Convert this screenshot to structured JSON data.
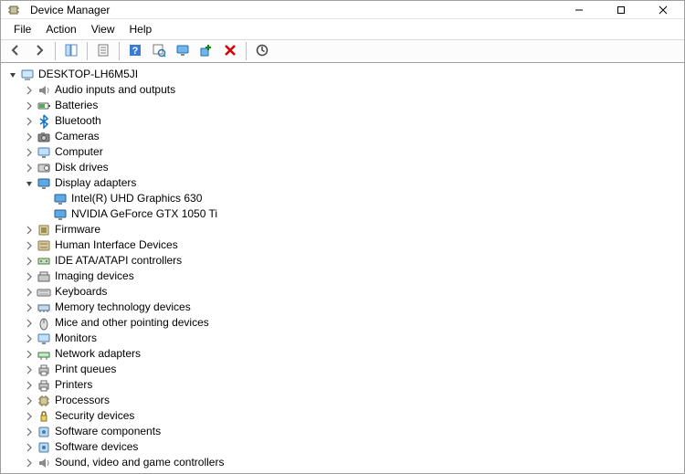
{
  "window": {
    "title": "Device Manager"
  },
  "menu": {
    "file": "File",
    "action": "Action",
    "view": "View",
    "help": "Help"
  },
  "toolbar_icons": {
    "back": "back-arrow",
    "forward": "forward-arrow",
    "showhide": "show-hide-console-tree",
    "properties": "properties",
    "help": "help",
    "scan": "scan-for-hardware-changes",
    "addlegacy": "show-hidden-devices",
    "uninstall": "uninstall",
    "disable": "disable",
    "update": "update-driver"
  },
  "root": {
    "label": "DESKTOP-LH6M5JI",
    "expanded": true
  },
  "cats": [
    {
      "label": "Audio inputs and outputs",
      "icon": "speaker",
      "exp": false
    },
    {
      "label": "Batteries",
      "icon": "battery",
      "exp": false
    },
    {
      "label": "Bluetooth",
      "icon": "bluetooth",
      "exp": false
    },
    {
      "label": "Cameras",
      "icon": "camera",
      "exp": false
    },
    {
      "label": "Computer",
      "icon": "computer",
      "exp": false
    },
    {
      "label": "Disk drives",
      "icon": "disk",
      "exp": false
    },
    {
      "label": "Display adapters",
      "icon": "display",
      "exp": true,
      "children": [
        {
          "label": "Intel(R) UHD Graphics 630",
          "icon": "display"
        },
        {
          "label": "NVIDIA GeForce GTX 1050 Ti",
          "icon": "display"
        }
      ]
    },
    {
      "label": "Firmware",
      "icon": "firmware",
      "exp": false
    },
    {
      "label": "Human Interface Devices",
      "icon": "hid",
      "exp": false
    },
    {
      "label": "IDE ATA/ATAPI controllers",
      "icon": "ide",
      "exp": false
    },
    {
      "label": "Imaging devices",
      "icon": "imaging",
      "exp": false
    },
    {
      "label": "Keyboards",
      "icon": "keyboard",
      "exp": false
    },
    {
      "label": "Memory technology devices",
      "icon": "memory",
      "exp": false
    },
    {
      "label": "Mice and other pointing devices",
      "icon": "mouse",
      "exp": false
    },
    {
      "label": "Monitors",
      "icon": "monitor",
      "exp": false
    },
    {
      "label": "Network adapters",
      "icon": "network",
      "exp": false
    },
    {
      "label": "Print queues",
      "icon": "printer",
      "exp": false
    },
    {
      "label": "Printers",
      "icon": "printer",
      "exp": false
    },
    {
      "label": "Processors",
      "icon": "cpu",
      "exp": false
    },
    {
      "label": "Security devices",
      "icon": "security",
      "exp": false
    },
    {
      "label": "Software components",
      "icon": "software",
      "exp": false
    },
    {
      "label": "Software devices",
      "icon": "software",
      "exp": false
    },
    {
      "label": "Sound, video and game controllers",
      "icon": "sound",
      "exp": false
    }
  ]
}
